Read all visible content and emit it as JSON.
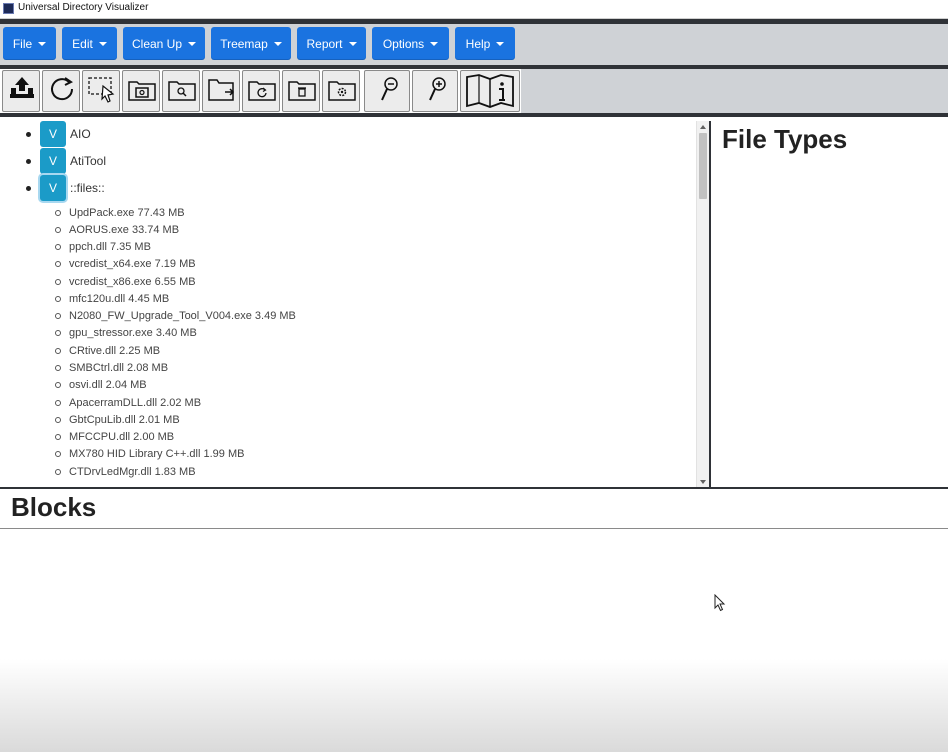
{
  "window": {
    "title": "Universal Directory Visualizer"
  },
  "menu": {
    "items": [
      {
        "label": "File"
      },
      {
        "label": "Edit"
      },
      {
        "label": "Clean Up"
      },
      {
        "label": "Treemap"
      },
      {
        "label": "Report"
      },
      {
        "label": "Options"
      },
      {
        "label": "Help"
      }
    ],
    "accent": "#1a73e0"
  },
  "toolbar": {
    "buttons": [
      {
        "icon": "upload-icon"
      },
      {
        "icon": "refresh-icon"
      },
      {
        "icon": "select-icon"
      },
      {
        "icon": "folder-image-icon"
      },
      {
        "icon": "folder-search-icon"
      },
      {
        "icon": "folder-open-icon"
      },
      {
        "icon": "folder-refresh-icon"
      },
      {
        "icon": "folder-delete-icon"
      },
      {
        "icon": "folder-settings-icon"
      },
      {
        "icon": "zoom-out-icon"
      },
      {
        "icon": "zoom-in-icon"
      },
      {
        "icon": "info-book-icon"
      }
    ]
  },
  "tree": {
    "roots": [
      {
        "toggle": "V",
        "label": "AIO"
      },
      {
        "toggle": "V",
        "label": "AtiTool"
      },
      {
        "toggle": "V",
        "label": "::files::"
      }
    ],
    "files": [
      "UpdPack.exe 77.43 MB",
      "AORUS.exe 33.74 MB",
      "ppch.dll 7.35 MB",
      "vcredist_x64.exe 7.19 MB",
      "vcredist_x86.exe 6.55 MB",
      "mfc120u.dll 4.45 MB",
      "N2080_FW_Upgrade_Tool_V004.exe 3.49 MB",
      "gpu_stressor.exe 3.40 MB",
      "CRtive.dll 2.25 MB",
      "SMBCtrl.dll 2.08 MB",
      "osvi.dll 2.04 MB",
      "ApacerramDLL.dll 2.02 MB",
      "GbtCpuLib.dll 2.01 MB",
      "MFCCPU.dll 2.00 MB",
      "MX780 HID Library C++.dll 1.99 MB",
      "CTDrvLedMgr.dll 1.83 MB"
    ]
  },
  "panels": {
    "file_types_title": "File Types",
    "blocks_title": "Blocks"
  }
}
